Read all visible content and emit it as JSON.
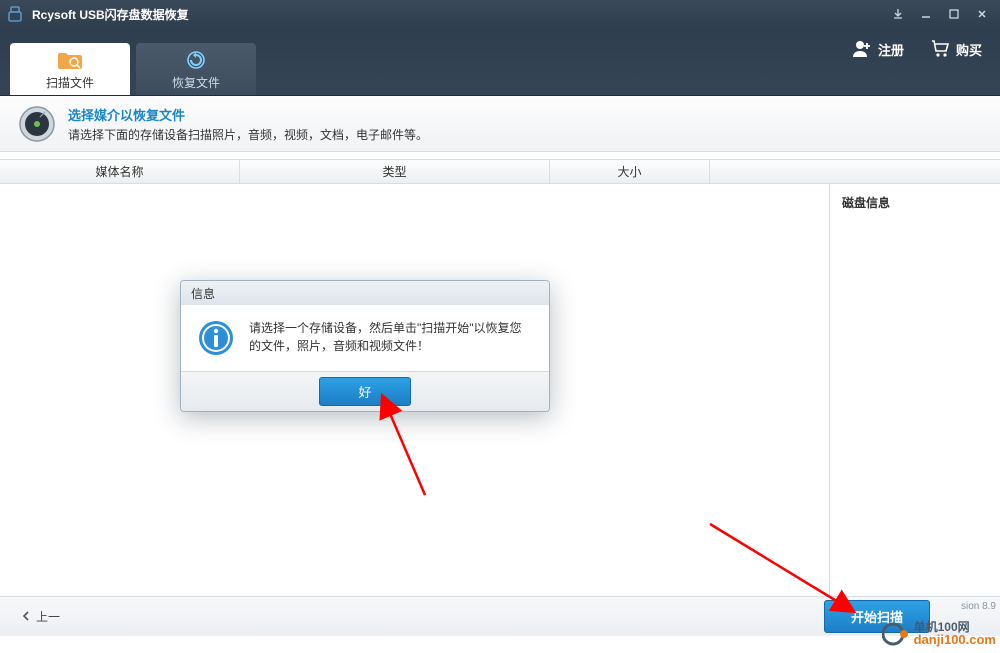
{
  "window": {
    "title": "Rcysoft USB闪存盘数据恢复"
  },
  "topbar": {
    "tab_scan": "扫描文件",
    "tab_recover": "恢复文件",
    "register": "注册",
    "buy": "购买"
  },
  "instruction": {
    "line1": "选择媒介以恢复文件",
    "line2": "请选择下面的存储设备扫描照片，音频，视频，文档，电子邮件等。"
  },
  "columns": {
    "name": "媒体名称",
    "type": "类型",
    "size": "大小"
  },
  "side": {
    "disk_info": "磁盘信息"
  },
  "dialog": {
    "title": "信息",
    "message": "请选择一个存储设备，然后单击\"扫描开始\"以恢复您的文件，照片，音频和视频文件！",
    "ok": "好"
  },
  "footer": {
    "back": "上一",
    "scan": "开始扫描"
  },
  "misc": {
    "version": "sion 8.9",
    "watermark_cn": "单机100网",
    "watermark_en": "danji100.com"
  }
}
